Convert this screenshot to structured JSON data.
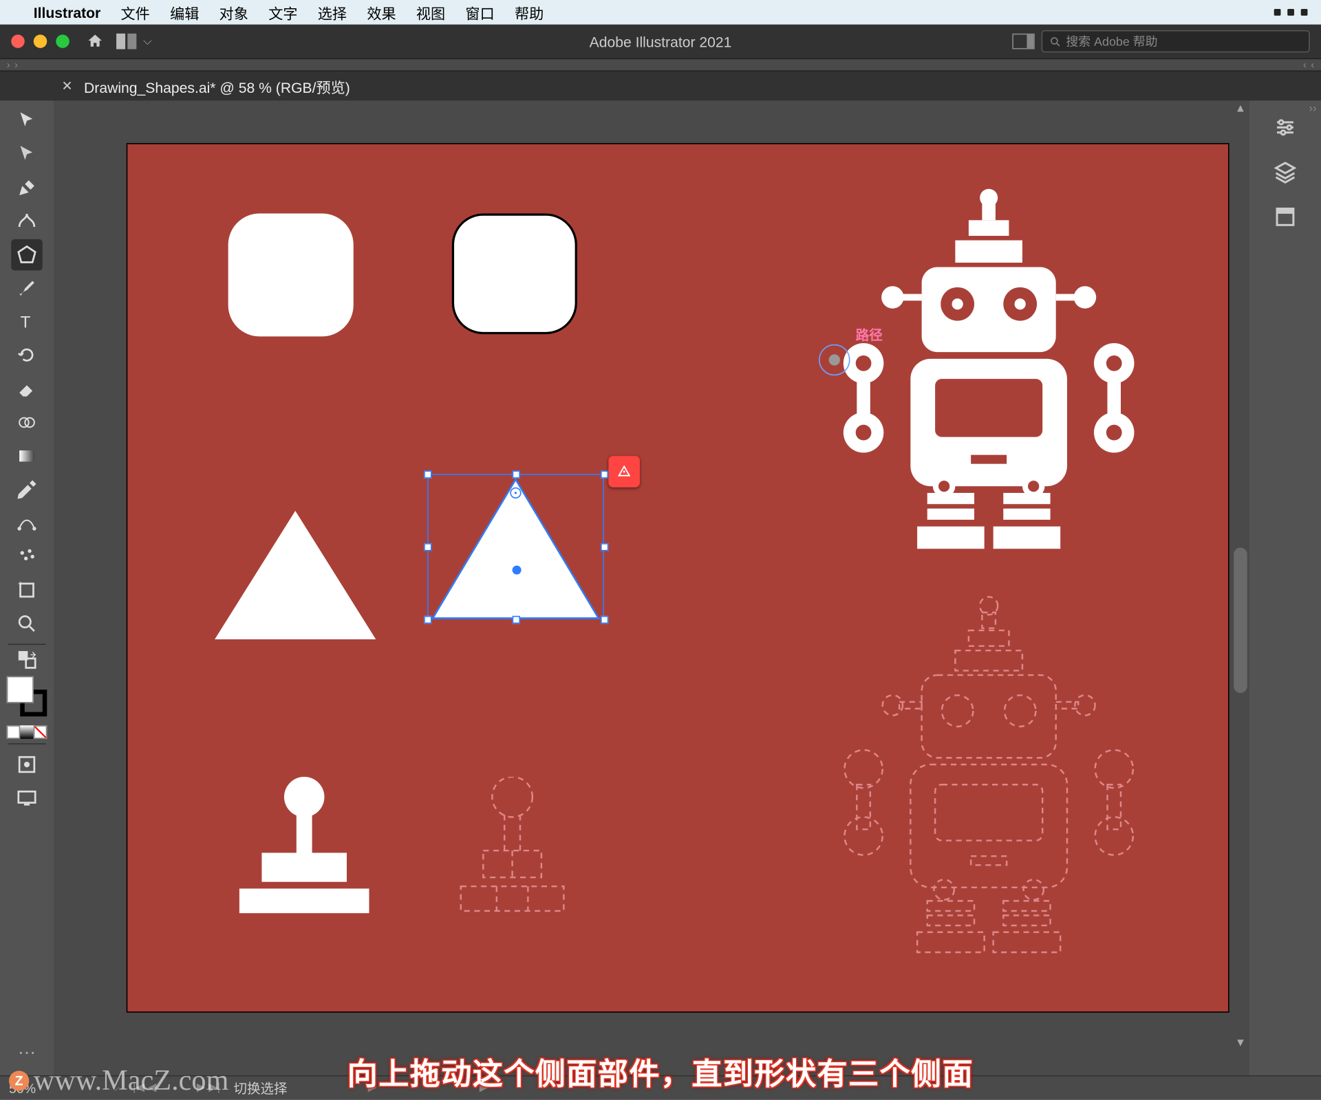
{
  "menubar": {
    "app": "Illustrator",
    "items": [
      "文件",
      "编辑",
      "对象",
      "文字",
      "选择",
      "效果",
      "视图",
      "窗口",
      "帮助"
    ]
  },
  "titlebar": {
    "title": "Adobe Illustrator 2021",
    "search_placeholder": "搜索 Adobe 帮助"
  },
  "tab": {
    "label": "Drawing_Shapes.ai* @ 58 % (RGB/预览)"
  },
  "path_label": "路径",
  "status": {
    "zoom": "50%",
    "mode": "切换选择"
  },
  "caption": "向上拖动这个侧面部件，直到形状有三个侧面",
  "watermark": "www.MacZ.com",
  "zbadge": "Z",
  "icons": {
    "selection": "selection",
    "direct": "direct-selection",
    "pen": "pen",
    "curvature": "curvature",
    "polygon": "polygon",
    "brush": "brush",
    "type": "type",
    "rotate": "rotate",
    "eraser": "eraser",
    "shapebuilder": "shape-builder",
    "gradient": "gradient",
    "eyedropper": "eyedropper",
    "blend": "blend",
    "symbol": "symbol-sprayer",
    "artboard": "artboard",
    "zoom": "zoom",
    "drawmode": "draw-mode",
    "screen": "screen-mode"
  },
  "colors": {
    "fill": "#ffffff",
    "stroke": "#000000",
    "canvas": "#a94038",
    "accent": "#2f7dff"
  }
}
